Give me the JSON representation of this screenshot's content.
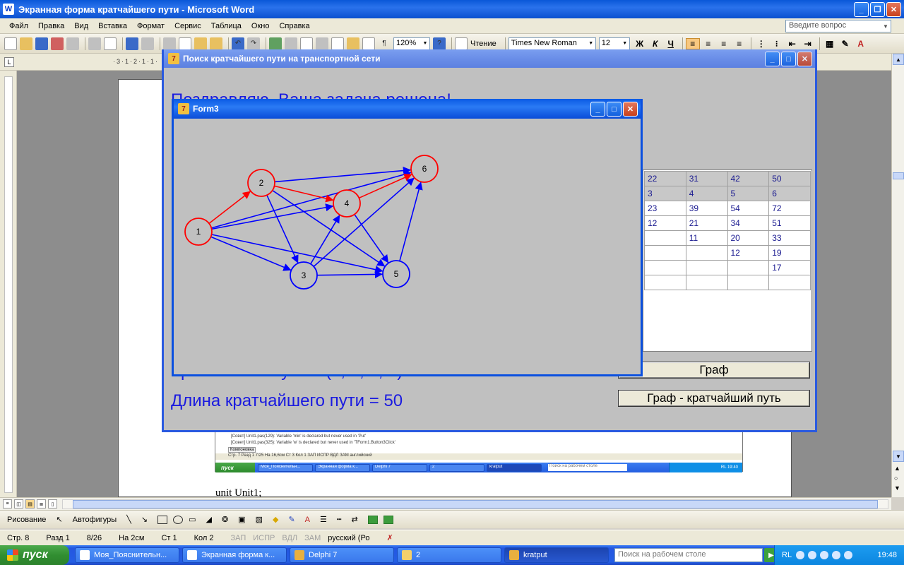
{
  "word": {
    "title": "Экранная форма кратчайшего пути - Microsoft Word",
    "menu": [
      "Файл",
      "Правка",
      "Вид",
      "Вставка",
      "Формат",
      "Сервис",
      "Таблица",
      "Окно",
      "Справка"
    ],
    "ask_placeholder": "Введите вопрос",
    "zoom": "120%",
    "reading_label": "Чтение",
    "font_name": "Times New Roman",
    "font_size": "12",
    "bold": "Ж",
    "italic": "К",
    "underline": "Ч",
    "doc_text": "unit Unit1;",
    "status": {
      "page": "Стр. 8",
      "section": "Разд 1",
      "pages": "8/26",
      "at": "На 2см",
      "line": "Ст 1",
      "col": "Кол 2",
      "rec": "ЗАП",
      "trk": "ИСПР",
      "ext": "ВДЛ",
      "ovr": "ЗАМ",
      "lang": "русский (Ро"
    },
    "drawing": {
      "draw_label": "Рисование",
      "autoshapes_label": "Автофигуры"
    }
  },
  "embedded": {
    "msg1": "[Совет] Unit1.pas(129): Variable 'min' is declared but never used in 'Put'",
    "msg2": "[Совет] Unit1.pas(325): Variable 'w' is declared but never used in 'TForm1.Button3Click'",
    "tab": "Компоновка",
    "status": "Стр. 7     Разд 1          7/25      На 16,6см   Ст 3     Кол 1          ЗАП  ИСПР  ВДЛ  ЗАМ  английский",
    "start": "пуск",
    "tasks": [
      "Моя_Пояснительн...",
      "Экранная форма к...",
      "Delphi 7",
      "2",
      "kratput"
    ],
    "search": "Поиск на рабочем столе",
    "tray": "RL     19:40"
  },
  "main_form": {
    "title": "Поиск кратчайшего пути на транспортной сети",
    "line1": "Поздравляю. Ваша задача решена!",
    "line2": "Кратчайший путь = (1, 2, 4, 6).",
    "line3": "Длина кратчайшего пути = 50",
    "grid_header": [
      "22",
      "31",
      "42",
      "50"
    ],
    "grid_index": [
      "3",
      "4",
      "5",
      "6"
    ],
    "grid_rows": [
      [
        "23",
        "39",
        "54",
        "72"
      ],
      [
        "12",
        "21",
        "34",
        "51"
      ],
      [
        "",
        "11",
        "20",
        "33"
      ],
      [
        "",
        "",
        "12",
        "19"
      ],
      [
        "",
        "",
        "",
        "17"
      ],
      [
        "",
        "",
        "",
        ""
      ]
    ],
    "btn_graph": "Граф",
    "btn_shortest": "Граф - кратчайший путь"
  },
  "form3": {
    "title": "Form3",
    "nodes": [
      {
        "id": "1",
        "on_path": true
      },
      {
        "id": "2",
        "on_path": true
      },
      {
        "id": "3",
        "on_path": false
      },
      {
        "id": "4",
        "on_path": true
      },
      {
        "id": "5",
        "on_path": false
      },
      {
        "id": "6",
        "on_path": true
      }
    ],
    "edges": [
      {
        "from": "1",
        "to": "2",
        "on_path": true
      },
      {
        "from": "2",
        "to": "4",
        "on_path": true
      },
      {
        "from": "4",
        "to": "6",
        "on_path": true
      },
      {
        "from": "1",
        "to": "3",
        "on_path": false
      },
      {
        "from": "1",
        "to": "4",
        "on_path": false
      },
      {
        "from": "1",
        "to": "5",
        "on_path": false
      },
      {
        "from": "1",
        "to": "6",
        "on_path": false
      },
      {
        "from": "2",
        "to": "3",
        "on_path": false
      },
      {
        "from": "2",
        "to": "5",
        "on_path": false
      },
      {
        "from": "2",
        "to": "6",
        "on_path": false
      },
      {
        "from": "3",
        "to": "4",
        "on_path": false
      },
      {
        "from": "3",
        "to": "5",
        "on_path": false
      },
      {
        "from": "3",
        "to": "6",
        "on_path": false
      },
      {
        "from": "4",
        "to": "5",
        "on_path": false
      },
      {
        "from": "5",
        "to": "6",
        "on_path": false
      }
    ],
    "colors": {
      "path": "#ff0000",
      "other": "#0000ff"
    }
  },
  "taskbar": {
    "start": "пуск",
    "tasks": [
      "Моя_Пояснительн...",
      "Экранная форма к...",
      "Delphi 7",
      "2",
      "kratput"
    ],
    "search": "Поиск на рабочем столе",
    "lang": "RL",
    "clock": "19:48"
  }
}
